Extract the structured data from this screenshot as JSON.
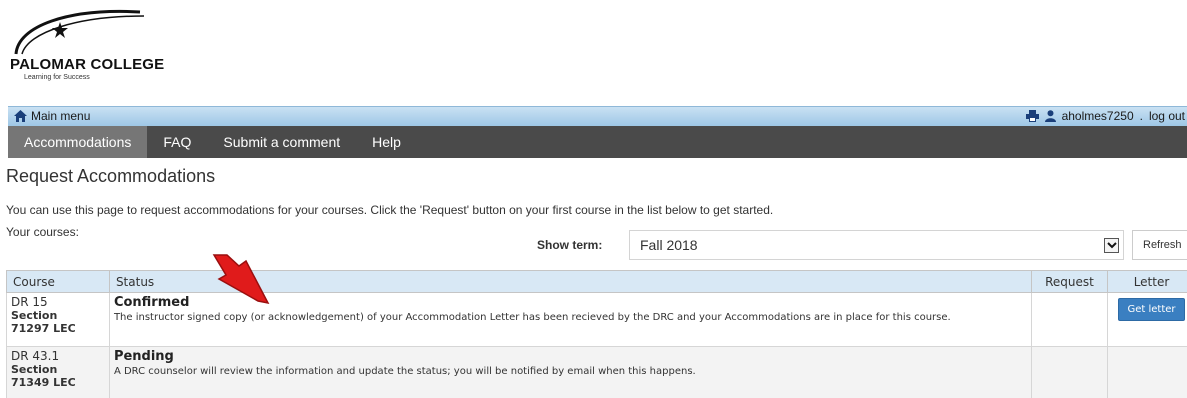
{
  "logo": {
    "name": "PALOMAR COLLEGE",
    "tagline": "Learning for Success"
  },
  "topbar": {
    "home_label": "Main menu",
    "user_label": "aholmes7250",
    "separator": ".",
    "logout_label": "log out"
  },
  "nav": {
    "tabs": [
      "Accommodations",
      "FAQ",
      "Submit a comment",
      "Help"
    ],
    "active": "Accommodations"
  },
  "page": {
    "title": "Request Accommodations",
    "intro": "You can use this page to request accommodations for your courses. Click the 'Request' button on your first course in the list below to get started.",
    "your_courses_label": "Your courses:",
    "term_label": "Show term:",
    "term_value": "Fall 2018",
    "refresh_label": "Refresh"
  },
  "table": {
    "headers": [
      "Course",
      "Status",
      "Request",
      "Letter"
    ],
    "rows": [
      {
        "course": "DR 15",
        "section_label": "Section",
        "section": "71297 LEC",
        "status_title": "Confirmed",
        "status_desc": "The instructor signed copy (or acknowledgement) of your Accommodation Letter has been recieved by the DRC and your Accommodations are in place for this course.",
        "request": "",
        "letter_button": "Get letter"
      },
      {
        "course": "DR 43.1",
        "section_label": "Section",
        "section": "71349 LEC",
        "status_title": "Pending",
        "status_desc": "A DRC counselor will review the information and update the status; you will be notified by email when this happens.",
        "request": "",
        "letter_button": ""
      }
    ]
  },
  "colors": {
    "topbar": "#9ec7e6",
    "navbar": "#4a4a4a",
    "nav_active": "#767676",
    "table_header": "#d8e8f5",
    "button": "#3a7fc1",
    "annotation_arrow": "#e01b1b"
  },
  "icons": {
    "home": "home-icon",
    "print": "print-icon",
    "user": "user-icon",
    "dropdown": "chevron-down-icon",
    "annotation": "red-arrow-icon"
  }
}
